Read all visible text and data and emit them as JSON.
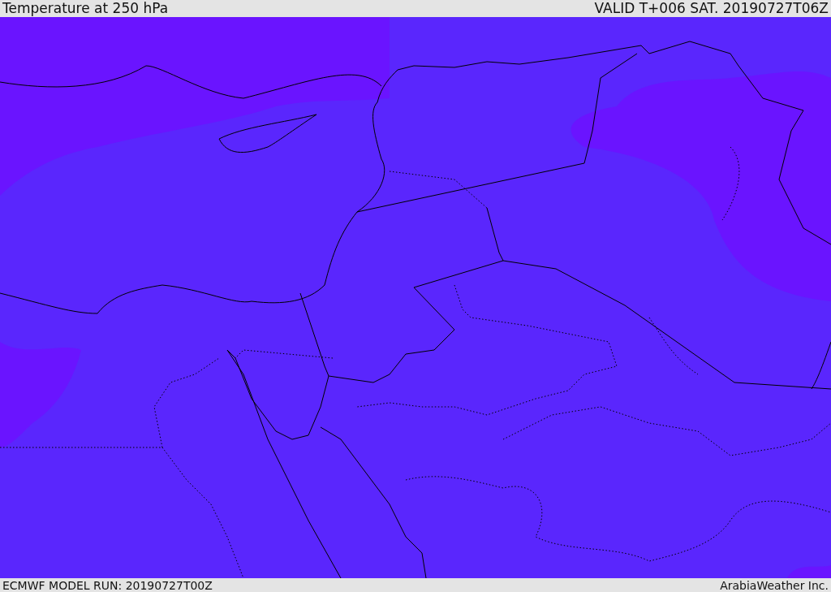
{
  "header": {
    "title": "Temperature at 250 hPa",
    "valid": "VALID T+006 SAT. 20190727T06Z"
  },
  "footer": {
    "model_run": "ECMWF MODEL RUN: 20190727T00Z",
    "credit": "ArabiaWeather Inc."
  }
}
